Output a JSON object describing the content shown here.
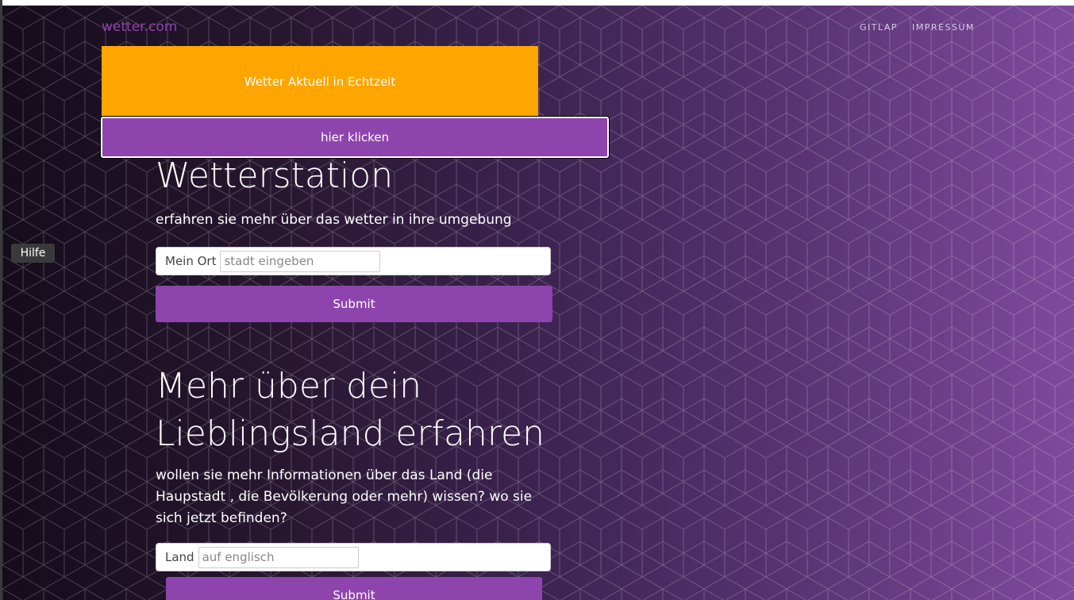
{
  "nav": {
    "brand": "wetter.com",
    "links": [
      {
        "label": "GITLAP"
      },
      {
        "label": "IMPRESSUM"
      }
    ]
  },
  "banner": {
    "yellow_text": "Wetter Aktuell in Echtzeit",
    "purple_text": "hier klicken"
  },
  "section1": {
    "title": "Wetterstation",
    "subtitle": "erfahren sie mehr über das wetter in ihre umgebung",
    "input_label": "Mein Ort",
    "input_placeholder": "stadt eingeben",
    "submit_label": "Submit"
  },
  "section2": {
    "title": "Mehr über dein Lieblingsland erfahren",
    "subtitle": "wollen sie mehr Informationen über das Land (die Haupstadt , die Bevölkerung oder mehr) wissen? wo sie sich jetzt befinden?",
    "input_label": "Land",
    "input_placeholder": "auf englisch",
    "submit_label": "Submit"
  },
  "help": {
    "label": "Hilfe"
  },
  "colors": {
    "accent": "#8e44ad",
    "banner": "#ffa500",
    "bg_start": "#150c1b",
    "bg_end": "#7e4a9d"
  }
}
